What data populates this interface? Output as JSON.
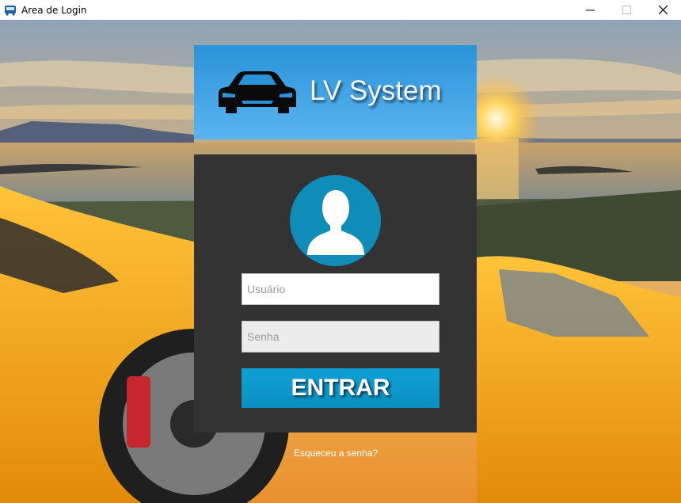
{
  "window": {
    "title": "Area de Login",
    "app_icon": "bus-icon"
  },
  "banner": {
    "brand": "LV System",
    "logo_icon": "car-icon"
  },
  "login": {
    "avatar_icon": "user-avatar-icon",
    "username_placeholder": "Usuário",
    "password_placeholder": "Senha",
    "submit_label": "ENTRAR",
    "forgot_link": "Esqueceu a senha?"
  },
  "colors": {
    "banner": "#3aa0e2",
    "panel": "#333333",
    "accent": "#0c96c8",
    "car_body": "#f5a712"
  }
}
